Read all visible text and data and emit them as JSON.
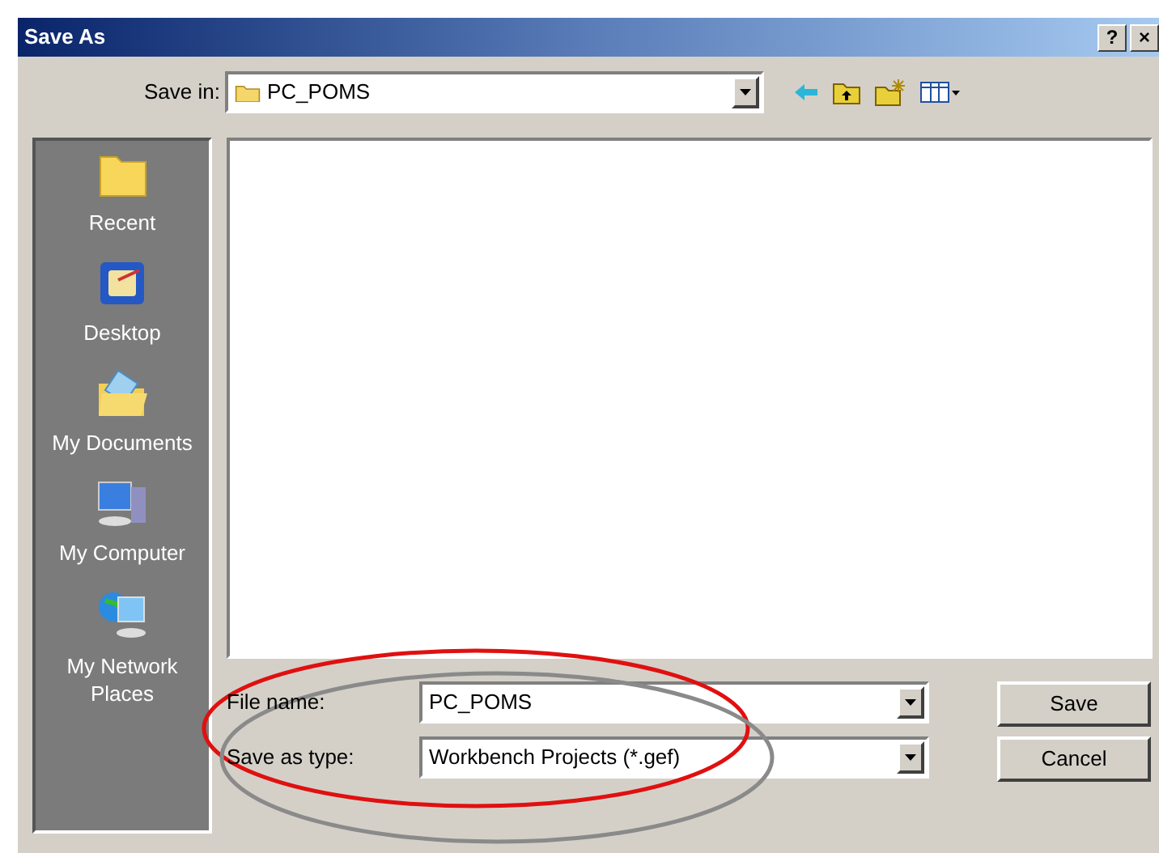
{
  "window": {
    "title": "Save As",
    "title_buttons": [
      "?",
      "×"
    ]
  },
  "save_in": {
    "label": "Save in:",
    "value": "PC_POMS"
  },
  "sidebar": {
    "items": [
      {
        "kind": "recent",
        "label": "Recent"
      },
      {
        "kind": "desktop",
        "label": "Desktop"
      },
      {
        "kind": "documents",
        "label": "My Documents"
      },
      {
        "kind": "computer",
        "label": "My Computer"
      },
      {
        "kind": "network",
        "label": "My Network Places"
      }
    ]
  },
  "file_name": {
    "label": "File name:",
    "value": "PC_POMS"
  },
  "save_as_type": {
    "label": "Save as type:",
    "value": "Workbench Projects (*.gef)"
  },
  "buttons": [
    "Save",
    "Cancel"
  ]
}
